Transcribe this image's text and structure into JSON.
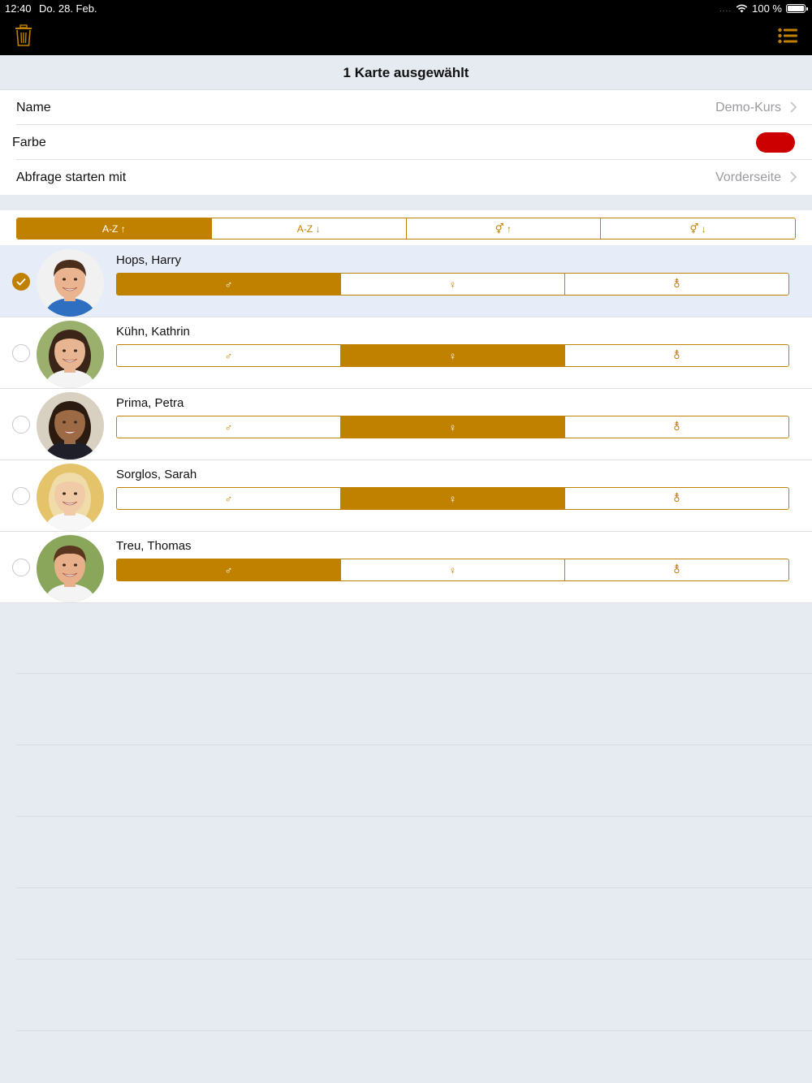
{
  "status_bar": {
    "time": "12:40",
    "date": "Do. 28. Feb.",
    "signal_dots": "....",
    "battery": "100 %"
  },
  "toolbar": {
    "left_icon": "trash-icon",
    "right_icon": "list-icon",
    "accent": "#c08000"
  },
  "header": {
    "title": "1 Karte ausgewählt"
  },
  "settings": {
    "name_label": "Name",
    "name_value": "Demo-Kurs",
    "color_label": "Farbe",
    "color_value": "#cc0000",
    "start_label": "Abfrage starten mit",
    "start_value": "Vorderseite"
  },
  "sort_options": [
    {
      "label": "A-Z ↑",
      "selected": true
    },
    {
      "label": "A-Z ↓",
      "selected": false
    },
    {
      "label": "⚥ ↑",
      "selected": false
    },
    {
      "label": "⚥ ↓",
      "selected": false
    }
  ],
  "gender_options": [
    "♂",
    "♀",
    "⚨"
  ],
  "students": [
    {
      "name": "Hops, Harry",
      "checked": true,
      "gender_selected": 0
    },
    {
      "name": "Kühn, Kathrin",
      "checked": false,
      "gender_selected": 1
    },
    {
      "name": "Prima, Petra",
      "checked": false,
      "gender_selected": 1
    },
    {
      "name": "Sorglos, Sarah",
      "checked": false,
      "gender_selected": 1
    },
    {
      "name": "Treu, Thomas",
      "checked": false,
      "gender_selected": 0
    }
  ]
}
